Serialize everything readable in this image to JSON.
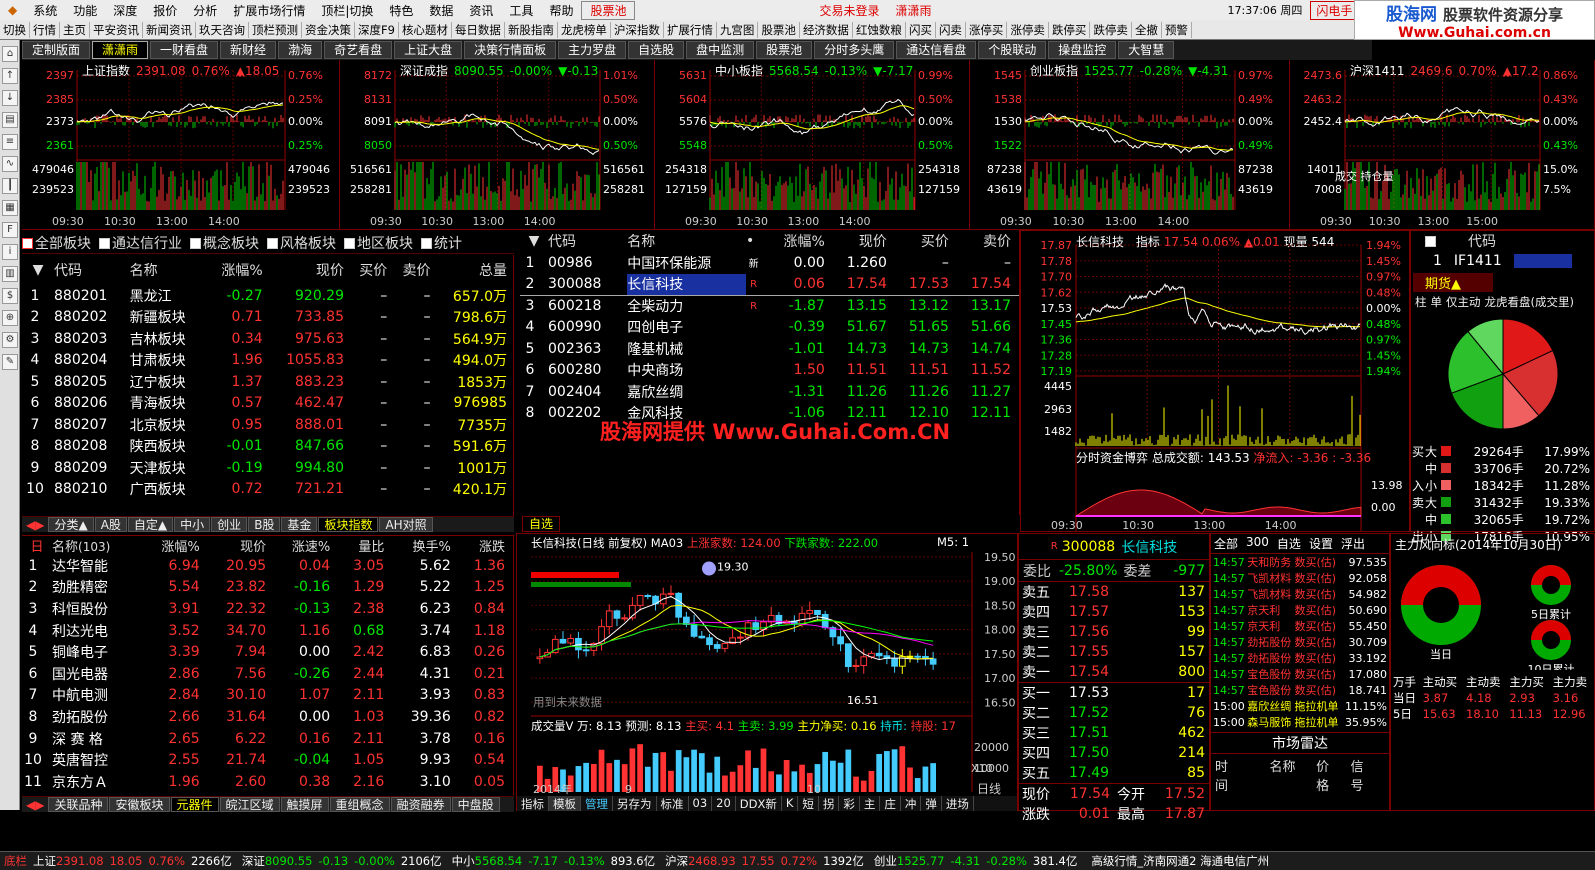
{
  "menu": {
    "items": [
      "系统",
      "功能",
      "深度",
      "报价",
      "分析",
      "扩展市场行情",
      "顶栏|切换",
      "特色",
      "数据",
      "资讯",
      "工具",
      "帮助"
    ],
    "stockpool": "股票池",
    "login": "交易未登录",
    "user": "潇潇雨",
    "time": "17:37:06 周四",
    "flash": "闪电手",
    "quote": "行 情"
  },
  "logo": {
    "title": "股海网",
    "subtitle": "股票软件资源分享",
    "url": "Www.Guhai.com.cn"
  },
  "toolbar": [
    "切换",
    "行情",
    "主页",
    "平安资讯",
    "新闻资讯",
    "玖天咨询",
    "顶栏预测",
    "资金决策",
    "深度F9",
    "核心题材",
    "每日数据",
    "新股指南",
    "龙虎榜单",
    "沪深指数",
    "扩展行情",
    "九宫图",
    "股票池",
    "经济数据",
    "红蚀数粮",
    "闪买",
    "闪卖",
    "涨停买",
    "涨停卖",
    "跌停买",
    "跌停卖",
    "全撤",
    "预警"
  ],
  "tabs": [
    "定制版面",
    "潇潇雨",
    "一财看盘",
    "新财经",
    "渤海",
    "奇艺看盘",
    "上证大盘",
    "决策行情面板",
    "主力罗盘",
    "自选股",
    "盘中监测",
    "股票池",
    "分时多头鹰",
    "通达信看盘",
    "个股联动",
    "操盘监控",
    "大智慧"
  ],
  "mini_charts": [
    {
      "name": "上证指数",
      "price": "2391.08",
      "pct": "0.76%",
      "chg": "▲18.05",
      "dir": "up",
      "ylabels": [
        "2397",
        "2385",
        "2373",
        "2361",
        "479046",
        "239523"
      ],
      "rlabels": [
        "0.76%",
        "0.25%",
        "0.00%",
        "0.25%",
        "479046",
        "239523"
      ],
      "times": [
        "09:30",
        "10:30",
        "13:00",
        "14:00"
      ]
    },
    {
      "name": "深证成指",
      "price": "8090.55",
      "pct": "-0.00%",
      "chg": "▼-0.13",
      "dir": "down",
      "ylabels": [
        "8172",
        "8131",
        "8091",
        "8050",
        "516561",
        "258281"
      ],
      "rlabels": [
        "1.01%",
        "0.50%",
        "0.00%",
        "0.50%",
        "516561",
        "258281"
      ],
      "times": [
        "09:30",
        "10:30",
        "13:00",
        "14:00"
      ]
    },
    {
      "name": "中小板指",
      "price": "5568.54",
      "pct": "-0.13%",
      "chg": "▼-7.17",
      "dir": "down",
      "ylabels": [
        "5631",
        "5604",
        "5576",
        "5548",
        "254318",
        "127159"
      ],
      "rlabels": [
        "0.99%",
        "0.50%",
        "0.00%",
        "0.50%",
        "254318",
        "127159"
      ],
      "times": [
        "09:30",
        "10:30",
        "13:00",
        "14:00"
      ]
    },
    {
      "name": "创业板指",
      "price": "1525.77",
      "pct": "-0.28%",
      "chg": "▼-4.31",
      "dir": "down",
      "ylabels": [
        "1545",
        "1538",
        "1530",
        "1522",
        "87238",
        "43619"
      ],
      "rlabels": [
        "0.97%",
        "0.49%",
        "0.00%",
        "0.49%",
        "87238",
        "43619"
      ],
      "times": [
        "09:30",
        "10:30",
        "13:00",
        "14:00"
      ]
    },
    {
      "name": "沪深1411",
      "price": "2469.6",
      "pct": "0.70%",
      "chg": "▲17.2",
      "dir": "up",
      "ylabels": [
        "2473.6",
        "2463.2",
        "2452.4",
        "",
        "14011",
        "7008"
      ],
      "rlabels": [
        "0.86%",
        "0.43%",
        "0.00%",
        "0.43%",
        "15.0%",
        "7.5%"
      ],
      "times": [
        "09:30",
        "10:30",
        "13:00",
        "15:00"
      ],
      "extra": "成交 持仓量"
    }
  ],
  "filters": [
    "全部板块",
    "通达信行业",
    "概念板块",
    "风格板块",
    "地区板块",
    "统计"
  ],
  "sector_header": [
    "代码",
    "名称",
    "涨幅%",
    "现价",
    "买价",
    "卖价",
    "总量"
  ],
  "sectors": [
    [
      "1",
      "880201",
      "黑龙江",
      "-0.27",
      "920.29",
      "–",
      "–",
      "657.0万"
    ],
    [
      "2",
      "880202",
      "新疆板块",
      "0.71",
      "733.85",
      "–",
      "–",
      "798.6万"
    ],
    [
      "3",
      "880203",
      "吉林板块",
      "0.34",
      "975.63",
      "–",
      "–",
      "564.9万"
    ],
    [
      "4",
      "880204",
      "甘肃板块",
      "1.96",
      "1055.83",
      "–",
      "–",
      "494.0万"
    ],
    [
      "5",
      "880205",
      "辽宁板块",
      "1.37",
      "883.23",
      "–",
      "–",
      "1853万"
    ],
    [
      "6",
      "880206",
      "青海板块",
      "0.57",
      "462.47",
      "–",
      "–",
      "976985"
    ],
    [
      "7",
      "880207",
      "北京板块",
      "0.95",
      "888.01",
      "–",
      "–",
      "7735万"
    ],
    [
      "8",
      "880208",
      "陕西板块",
      "-0.01",
      "847.66",
      "–",
      "–",
      "591.6万"
    ],
    [
      "9",
      "880209",
      "天津板块",
      "-0.19",
      "994.80",
      "–",
      "–",
      "1001万"
    ],
    [
      "10",
      "880210",
      "广西板块",
      "0.72",
      "721.21",
      "–",
      "–",
      "420.1万"
    ]
  ],
  "sector_tabs": [
    "分类▲",
    "A股",
    "自定▲",
    "中小",
    "创业",
    "B股",
    "基金",
    "板块指数",
    "AH对照"
  ],
  "watch_header": [
    "代码",
    "名称",
    "•",
    "涨幅%",
    "现价",
    "买价",
    "卖价"
  ],
  "watch": [
    [
      "1",
      "00986",
      "中国环保能源",
      "新",
      "0.00",
      "1.260",
      "–",
      "–"
    ],
    [
      "2",
      "300088",
      "长信科技",
      "R",
      "0.06",
      "17.54",
      "17.53",
      "17.54"
    ],
    [
      "3",
      "600218",
      "全柴动力",
      "R",
      "-1.87",
      "13.15",
      "13.12",
      "13.17"
    ],
    [
      "4",
      "600990",
      "四创电子",
      "",
      "-0.39",
      "51.67",
      "51.65",
      "51.66"
    ],
    [
      "5",
      "002363",
      "隆基机械",
      "",
      "-1.01",
      "14.73",
      "14.73",
      "14.74"
    ],
    [
      "6",
      "600280",
      "中央商场",
      "",
      "1.50",
      "11.51",
      "11.51",
      "11.52"
    ],
    [
      "7",
      "002404",
      "嘉欣丝绸",
      "",
      "-1.31",
      "11.26",
      "11.26",
      "11.27"
    ],
    [
      "8",
      "002202",
      "金风科技",
      "",
      "-1.06",
      "12.11",
      "12.10",
      "12.11"
    ]
  ],
  "watermark": "股海网提供 Www.Guhai.Com.CN",
  "watch_tab": "自选",
  "intraday": {
    "name": "长信科技",
    "label": "指标",
    "price": "17.54",
    "pct": "0.06%",
    "chg": "▲0.01",
    "vol": "现量 544",
    "ylabels": [
      "17.87",
      "17.78",
      "17.70",
      "17.62",
      "17.53",
      "17.45",
      "17.36",
      "17.28",
      "17.19",
      "4445",
      "2963",
      "1482"
    ],
    "rlabels": [
      "1.94%",
      "1.45%",
      "0.97%",
      "0.48%",
      "0.00%",
      "0.48%",
      "0.97%",
      "1.45%",
      "1.94%"
    ],
    "flow_title": "分时资金博弈",
    "flow_total": "总成交额: 143.53",
    "flow_net": "净流入: -3.36 : -3.36",
    "flow_right": [
      "13.98",
      "0.00"
    ],
    "times": [
      "09:30",
      "10:30",
      "13:00",
      "14:00"
    ]
  },
  "futures": {
    "code_hdr": "代码",
    "row": [
      "1",
      "IF1411"
    ],
    "tab": "期货▲",
    "tabs2": [
      "柱",
      "单",
      "仅主动",
      "龙虎看盘(成交里)"
    ],
    "rows": [
      [
        "买",
        "大",
        "29264手",
        "17.99%"
      ],
      [
        "",
        "中",
        "33706手",
        "20.72%"
      ],
      [
        "入",
        "小",
        "18342手",
        "11.28%"
      ],
      [
        "卖",
        "大",
        "31432手",
        "19.33%"
      ],
      [
        "",
        "中",
        "32065手",
        "19.72%"
      ],
      [
        "出",
        "小",
        "17816手",
        "10.95%"
      ]
    ]
  },
  "breadth": {
    "title": "自选",
    "count": "(103)",
    "header": [
      "名称",
      "涨幅%",
      "现价",
      "涨速%",
      "量比",
      "换手%",
      "涨跌"
    ],
    "rows": [
      [
        "1",
        "达华智能",
        "6.94",
        "20.95",
        "0.04",
        "3.05",
        "5.62",
        "1.36"
      ],
      [
        "2",
        "劲胜精密",
        "5.54",
        "23.82",
        "-0.16",
        "1.29",
        "5.22",
        "1.25"
      ],
      [
        "3",
        "科恒股份",
        "3.91",
        "22.32",
        "-0.13",
        "2.38",
        "6.23",
        "0.84"
      ],
      [
        "4",
        "利达光电",
        "3.52",
        "34.70",
        "1.16",
        "0.68",
        "3.74",
        "1.18"
      ],
      [
        "5",
        "铜峰电子",
        "3.39",
        "7.94",
        "0.00",
        "2.42",
        "6.83",
        "0.26"
      ],
      [
        "6",
        "国光电器",
        "2.86",
        "7.56",
        "-0.26",
        "2.44",
        "4.31",
        "0.21"
      ],
      [
        "7",
        "中航电测",
        "2.84",
        "30.10",
        "1.07",
        "2.11",
        "3.93",
        "0.83"
      ],
      [
        "8",
        "劲拓股份",
        "2.66",
        "31.64",
        "0.00",
        "1.03",
        "39.36",
        "0.82"
      ],
      [
        "9",
        "深 赛 格",
        "2.65",
        "6.22",
        "0.16",
        "2.11",
        "3.78",
        "0.16"
      ],
      [
        "10",
        "英唐智控",
        "2.55",
        "21.74",
        "-0.04",
        "1.05",
        "9.93",
        "0.54"
      ],
      [
        "11",
        "京东方Ａ",
        "1.96",
        "2.60",
        "0.38",
        "2.16",
        "3.10",
        "0.05"
      ]
    ]
  },
  "bottom_tabs": [
    "关联品种",
    "安徽板块",
    "元器件",
    "皖江区域",
    "触摸屏",
    "重组概念",
    "融资融券",
    "中盘股"
  ],
  "kline": {
    "title": "长信科技(日线 前复权) MA03",
    "up": "上涨家数: 124.00",
    "down": "下跌家数: 222.00",
    "m5": "M5: 1",
    "high": "19.30",
    "low": "16.51",
    "ylabels": [
      "19.50",
      "19.00",
      "18.50",
      "18.00",
      "17.50",
      "17.00",
      "16.50"
    ],
    "vol_title": "成交量V 万: 8.13 预测: 8.13",
    "buy": "主买: 4.1",
    "sell": "主卖: 3.99",
    "net": "主力净买: 0.16",
    "hold": "持币: ",
    "hold2": "持股: 17",
    "vlabels": [
      "20000",
      "10000"
    ],
    "x10": "X10",
    "dates": [
      "2014年",
      "9",
      "10"
    ],
    "note": "用到未来数据",
    "period": "日线",
    "tools": [
      "指标",
      "模板",
      "管理",
      "另存为",
      "标准",
      "03",
      "20",
      "DDX新",
      "K",
      "短",
      "拐",
      "彩",
      "主",
      "庄",
      "冲",
      "弹",
      "进场"
    ]
  },
  "orderbook": {
    "code": "300088",
    "name": "长信科技",
    "wb": "委比",
    "wbv": "-25.80%",
    "wc": "委差",
    "wcv": "-977",
    "sells": [
      [
        "卖五",
        "17.58",
        "137"
      ],
      [
        "卖四",
        "17.57",
        "153"
      ],
      [
        "卖三",
        "17.56",
        "99"
      ],
      [
        "卖二",
        "17.55",
        "157"
      ],
      [
        "卖一",
        "17.54",
        "800"
      ]
    ],
    "buys": [
      [
        "买一",
        "17.53",
        "17"
      ],
      [
        "买二",
        "17.52",
        "76"
      ],
      [
        "买三",
        "17.51",
        "462"
      ],
      [
        "买四",
        "17.50",
        "214"
      ],
      [
        "买五",
        "17.49",
        "85"
      ]
    ],
    "now": [
      "现价",
      "17.54",
      "今开",
      "17.52"
    ],
    "chg": [
      "涨跌",
      "0.01",
      "最高",
      "17.87"
    ]
  },
  "news": {
    "tabs": [
      "全部",
      "300",
      "自选",
      "设置",
      "浮出"
    ],
    "rows": [
      [
        "14:57",
        "天和防务",
        "数买(估)",
        "97.535"
      ],
      [
        "14:57",
        "飞凯材料",
        "数买(估)",
        "92.058"
      ],
      [
        "14:57",
        "飞凯材料",
        "数买(估)",
        "54.982"
      ],
      [
        "14:57",
        "京天利",
        "数买(估)",
        "50.690"
      ],
      [
        "14:57",
        "京天利",
        "数买(估)",
        "55.450"
      ],
      [
        "14:57",
        "劲拓股份",
        "数买(估)",
        "30.709"
      ],
      [
        "14:57",
        "劲拓股份",
        "数买(估)",
        "33.192"
      ],
      [
        "14:57",
        "宝色股份",
        "数买(估)",
        "17.080"
      ],
      [
        "14:57",
        "宝色股份",
        "数买(估)",
        "18.741"
      ],
      [
        "15:00",
        "嘉欣丝绸",
        "拖拉机单",
        "11.15%"
      ],
      [
        "15:00",
        "森马服饰",
        "拖拉机单",
        "35.95%"
      ]
    ],
    "radar": "市场雷达",
    "radar_hdr": [
      "时间",
      "名称",
      "价格",
      "信号"
    ]
  },
  "mainforce": {
    "title": "主力风向标(2014年10月30日)",
    "today": "当日",
    "d5": "5日累计",
    "d10": "10日累计",
    "hdr": [
      "万手",
      "主动买",
      "主动卖",
      "主力买",
      "主力卖"
    ],
    "rows": [
      [
        "当日",
        "3.87",
        "4.18",
        "2.93",
        "3.16"
      ],
      [
        "5日",
        "15.63",
        "18.10",
        "11.13",
        "12.96"
      ]
    ]
  },
  "status": {
    "label": "底栏",
    "items": [
      [
        "上证",
        "2391.08",
        "18.05",
        "0.76%",
        "2266亿"
      ],
      [
        "深证",
        "8090.55",
        "-0.13",
        "-0.00%",
        "2106亿"
      ],
      [
        "中小",
        "5568.54",
        "-7.17",
        "-0.13%",
        "893.6亿"
      ],
      [
        "沪深",
        "2468.93",
        "17.55",
        "0.72%",
        "1392亿"
      ],
      [
        "创业",
        "1525.77",
        "-4.31",
        "-0.28%",
        "381.4亿"
      ]
    ],
    "right": "高级行情_济南网通2 海通电信广州"
  },
  "colors": {
    "up": "#ff3232",
    "down": "#00e600",
    "accent": "#ffff00",
    "bg": "#000000",
    "border": "#770000"
  }
}
